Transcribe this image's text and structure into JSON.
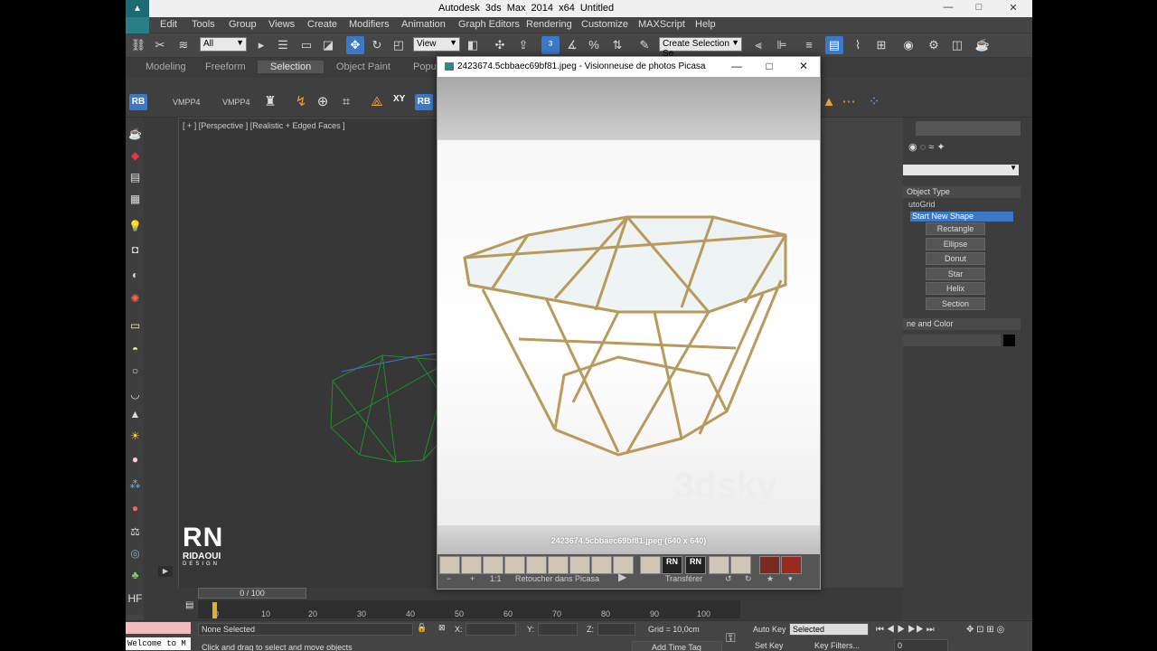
{
  "window": {
    "title": "Autodesk 3ds Max  2014 x64    Untitled",
    "controls": [
      "—",
      "□",
      "✕"
    ]
  },
  "menu": [
    "Edit",
    "Tools",
    "Group",
    "Views",
    "Create",
    "Modifiers",
    "Animation",
    "Graph Editors",
    "Rendering",
    "Customize",
    "MAXScript",
    "Help"
  ],
  "toolbar": {
    "filter_select": "All",
    "refcoord_select": "View",
    "named_selection": "Create Selection Se"
  },
  "ribbon_tabs": [
    "Modeling",
    "Freeform",
    "Selection",
    "Object Paint",
    "Popul"
  ],
  "ribbon_selected": "Selection",
  "ribbon2": {
    "rb1": "RB",
    "vmpp1": "VMPP4",
    "vmpp2": "VMPP4",
    "xy": "XY",
    "rb2": "RB"
  },
  "viewport": {
    "label": "[ + ] [Perspective ] [Realistic + Edged Faces ]"
  },
  "command_panel": {
    "rollout_object_type": "Object Type",
    "autogrid": "utoGrid",
    "start_new_shape": "Start New Shape",
    "buttons": [
      "Rectangle",
      "Ellipse",
      "Donut",
      "Star",
      "Helix",
      "Section"
    ],
    "rollout_name_color": "ne and Color"
  },
  "picasa": {
    "title": "2423674.5cbbaec69bf81.jpeg - Visionneuse de photos Picasa",
    "caption": "2423674.5cbbaec69bf81.jpeg (640 x 640)",
    "retouch_label": "Retoucher dans Picasa",
    "transfer_label": "Transférer",
    "thumb_label_a": "RN",
    "thumb_label_b": "RN",
    "watermark": "3dsky",
    "zoom_ratio": "1:1"
  },
  "logo": {
    "mark": "RN",
    "name": "RIDAOUI",
    "tagline": "DESIGN"
  },
  "timeline": {
    "frame": "0 / 100",
    "ticks": [
      "0",
      "10",
      "20",
      "30",
      "40",
      "50",
      "60",
      "70",
      "80",
      "90",
      "100"
    ]
  },
  "status": {
    "selection": "None Selected",
    "prompt": "Click and drag to select and move objects",
    "x_label": "X:",
    "y_label": "Y:",
    "z_label": "Z:",
    "grid": "Grid = 10,0cm",
    "add_time_tag": "Add Time Tag",
    "auto_key": "Auto Key",
    "set_key": "Set Key",
    "selected": "Selected",
    "key_filters": "Key Filters...",
    "frame_field": "0",
    "listener": "Welcome to M"
  }
}
